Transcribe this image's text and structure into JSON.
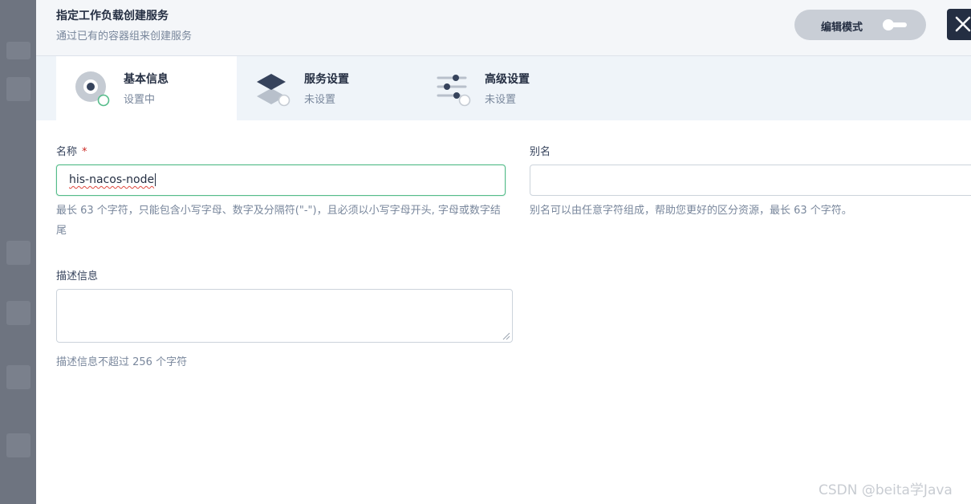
{
  "header": {
    "title": "指定工作负载创建服务",
    "subtitle": "通过已有的容器组来创建服务",
    "edit_mode_label": "编辑模式",
    "edit_mode_enabled": false,
    "close_icon": "close-icon"
  },
  "steps": [
    {
      "name": "基本信息",
      "status": "设置中",
      "icon": "basic-info-icon",
      "active": true
    },
    {
      "name": "服务设置",
      "status": "未设置",
      "icon": "layers-icon",
      "active": false
    },
    {
      "name": "高级设置",
      "status": "未设置",
      "icon": "sliders-icon",
      "active": false
    }
  ],
  "form": {
    "name": {
      "label": "名称",
      "required_mark": "*",
      "value": "his-nacos-node",
      "hint": "最长 63 个字符，只能包含小写字母、数字及分隔符(\"-\")，且必须以小写字母开头, 字母或数字结尾"
    },
    "alias": {
      "label": "别名",
      "value": "",
      "hint": "别名可以由任意字符组成，帮助您更好的区分资源，最长 63 个字符。"
    },
    "description": {
      "label": "描述信息",
      "value": "",
      "hint": "描述信息不超过 256 个字符"
    }
  },
  "watermark": "CSDN @beita学Java",
  "colors": {
    "accent_green": "#55bc8a",
    "dark": "#242e42",
    "muted": "#79879c",
    "required": "#ca2621"
  }
}
